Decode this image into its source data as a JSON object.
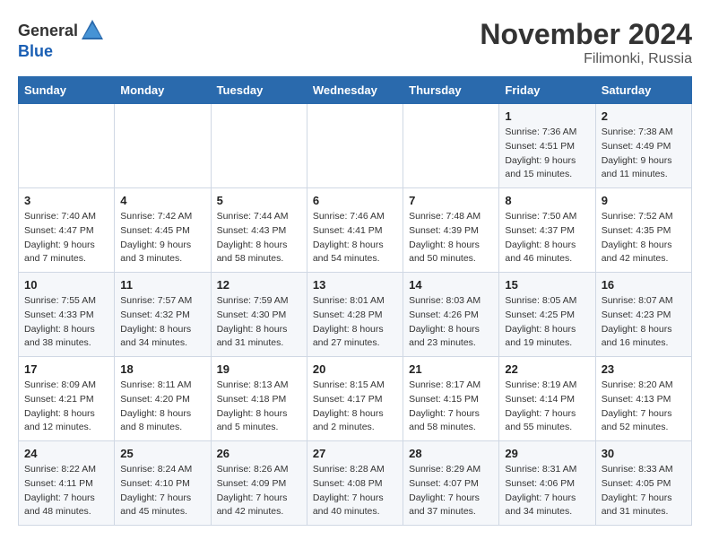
{
  "logo": {
    "general": "General",
    "blue": "Blue"
  },
  "title": "November 2024",
  "location": "Filimonki, Russia",
  "days_header": [
    "Sunday",
    "Monday",
    "Tuesday",
    "Wednesday",
    "Thursday",
    "Friday",
    "Saturday"
  ],
  "weeks": [
    [
      {
        "day": "",
        "info": ""
      },
      {
        "day": "",
        "info": ""
      },
      {
        "day": "",
        "info": ""
      },
      {
        "day": "",
        "info": ""
      },
      {
        "day": "",
        "info": ""
      },
      {
        "day": "1",
        "info": "Sunrise: 7:36 AM\nSunset: 4:51 PM\nDaylight: 9 hours\nand 15 minutes."
      },
      {
        "day": "2",
        "info": "Sunrise: 7:38 AM\nSunset: 4:49 PM\nDaylight: 9 hours\nand 11 minutes."
      }
    ],
    [
      {
        "day": "3",
        "info": "Sunrise: 7:40 AM\nSunset: 4:47 PM\nDaylight: 9 hours\nand 7 minutes."
      },
      {
        "day": "4",
        "info": "Sunrise: 7:42 AM\nSunset: 4:45 PM\nDaylight: 9 hours\nand 3 minutes."
      },
      {
        "day": "5",
        "info": "Sunrise: 7:44 AM\nSunset: 4:43 PM\nDaylight: 8 hours\nand 58 minutes."
      },
      {
        "day": "6",
        "info": "Sunrise: 7:46 AM\nSunset: 4:41 PM\nDaylight: 8 hours\nand 54 minutes."
      },
      {
        "day": "7",
        "info": "Sunrise: 7:48 AM\nSunset: 4:39 PM\nDaylight: 8 hours\nand 50 minutes."
      },
      {
        "day": "8",
        "info": "Sunrise: 7:50 AM\nSunset: 4:37 PM\nDaylight: 8 hours\nand 46 minutes."
      },
      {
        "day": "9",
        "info": "Sunrise: 7:52 AM\nSunset: 4:35 PM\nDaylight: 8 hours\nand 42 minutes."
      }
    ],
    [
      {
        "day": "10",
        "info": "Sunrise: 7:55 AM\nSunset: 4:33 PM\nDaylight: 8 hours\nand 38 minutes."
      },
      {
        "day": "11",
        "info": "Sunrise: 7:57 AM\nSunset: 4:32 PM\nDaylight: 8 hours\nand 34 minutes."
      },
      {
        "day": "12",
        "info": "Sunrise: 7:59 AM\nSunset: 4:30 PM\nDaylight: 8 hours\nand 31 minutes."
      },
      {
        "day": "13",
        "info": "Sunrise: 8:01 AM\nSunset: 4:28 PM\nDaylight: 8 hours\nand 27 minutes."
      },
      {
        "day": "14",
        "info": "Sunrise: 8:03 AM\nSunset: 4:26 PM\nDaylight: 8 hours\nand 23 minutes."
      },
      {
        "day": "15",
        "info": "Sunrise: 8:05 AM\nSunset: 4:25 PM\nDaylight: 8 hours\nand 19 minutes."
      },
      {
        "day": "16",
        "info": "Sunrise: 8:07 AM\nSunset: 4:23 PM\nDaylight: 8 hours\nand 16 minutes."
      }
    ],
    [
      {
        "day": "17",
        "info": "Sunrise: 8:09 AM\nSunset: 4:21 PM\nDaylight: 8 hours\nand 12 minutes."
      },
      {
        "day": "18",
        "info": "Sunrise: 8:11 AM\nSunset: 4:20 PM\nDaylight: 8 hours\nand 8 minutes."
      },
      {
        "day": "19",
        "info": "Sunrise: 8:13 AM\nSunset: 4:18 PM\nDaylight: 8 hours\nand 5 minutes."
      },
      {
        "day": "20",
        "info": "Sunrise: 8:15 AM\nSunset: 4:17 PM\nDaylight: 8 hours\nand 2 minutes."
      },
      {
        "day": "21",
        "info": "Sunrise: 8:17 AM\nSunset: 4:15 PM\nDaylight: 7 hours\nand 58 minutes."
      },
      {
        "day": "22",
        "info": "Sunrise: 8:19 AM\nSunset: 4:14 PM\nDaylight: 7 hours\nand 55 minutes."
      },
      {
        "day": "23",
        "info": "Sunrise: 8:20 AM\nSunset: 4:13 PM\nDaylight: 7 hours\nand 52 minutes."
      }
    ],
    [
      {
        "day": "24",
        "info": "Sunrise: 8:22 AM\nSunset: 4:11 PM\nDaylight: 7 hours\nand 48 minutes."
      },
      {
        "day": "25",
        "info": "Sunrise: 8:24 AM\nSunset: 4:10 PM\nDaylight: 7 hours\nand 45 minutes."
      },
      {
        "day": "26",
        "info": "Sunrise: 8:26 AM\nSunset: 4:09 PM\nDaylight: 7 hours\nand 42 minutes."
      },
      {
        "day": "27",
        "info": "Sunrise: 8:28 AM\nSunset: 4:08 PM\nDaylight: 7 hours\nand 40 minutes."
      },
      {
        "day": "28",
        "info": "Sunrise: 8:29 AM\nSunset: 4:07 PM\nDaylight: 7 hours\nand 37 minutes."
      },
      {
        "day": "29",
        "info": "Sunrise: 8:31 AM\nSunset: 4:06 PM\nDaylight: 7 hours\nand 34 minutes."
      },
      {
        "day": "30",
        "info": "Sunrise: 8:33 AM\nSunset: 4:05 PM\nDaylight: 7 hours\nand 31 minutes."
      }
    ]
  ]
}
